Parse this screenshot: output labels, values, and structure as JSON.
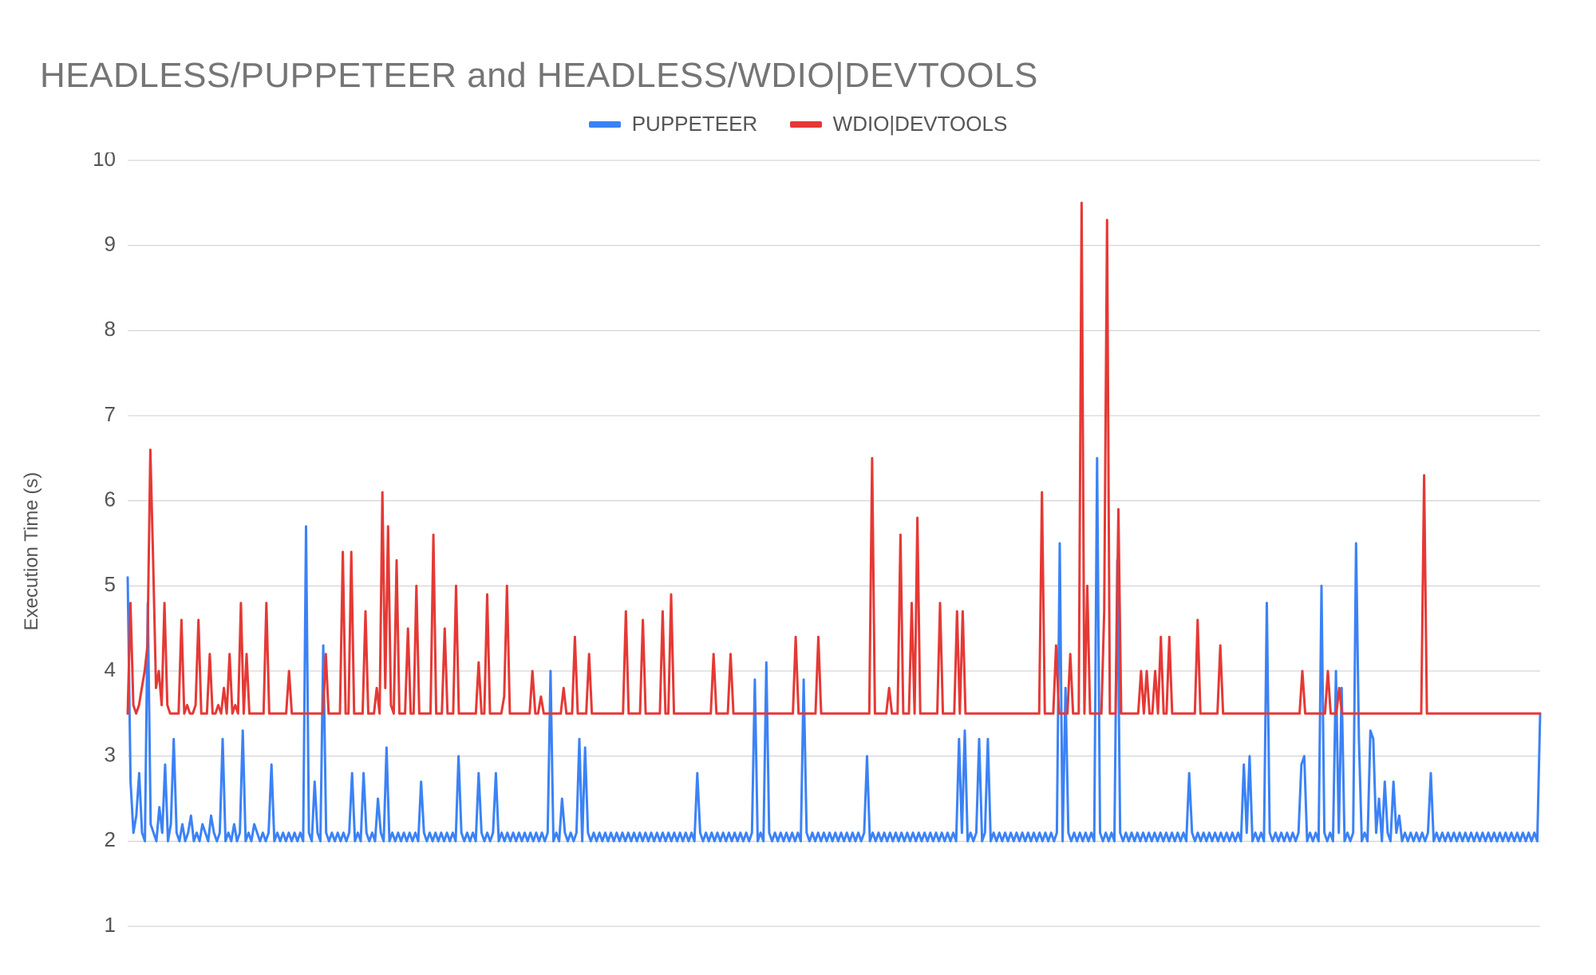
{
  "title": "HEADLESS/PUPPETEER and HEADLESS/WDIO|DEVTOOLS",
  "legend": {
    "series1": {
      "label": "PUPPETEER",
      "color": "#3b82f6"
    },
    "series2": {
      "label": "WDIO|DEVTOOLS",
      "color": "#e53935"
    }
  },
  "ylabel": "Execution Time (s)",
  "chart_data": {
    "type": "line",
    "title": "HEADLESS/PUPPETEER and HEADLESS/WDIO|DEVTOOLS",
    "xlabel": "",
    "ylabel": "Execution Time (s)",
    "ylim": [
      1,
      10
    ],
    "yticks": [
      1,
      2,
      3,
      4,
      5,
      6,
      7,
      8,
      9,
      10
    ],
    "x_count": 500,
    "series": [
      {
        "name": "PUPPETEER",
        "color": "#3b82f6",
        "values": [
          5.1,
          2.7,
          2.1,
          2.3,
          2.8,
          2.1,
          2.0,
          4.8,
          2.2,
          2.1,
          2.0,
          2.4,
          2.1,
          2.9,
          2.0,
          2.2,
          3.2,
          2.1,
          2.0,
          2.2,
          2.0,
          2.1,
          2.3,
          2.0,
          2.1,
          2.0,
          2.2,
          2.1,
          2.0,
          2.3,
          2.1,
          2.0,
          2.1,
          3.2,
          2.0,
          2.1,
          2.0,
          2.2,
          2.0,
          2.1,
          3.3,
          2.0,
          2.1,
          2.0,
          2.2,
          2.1,
          2.0,
          2.1,
          2.0,
          2.1,
          2.9,
          2.0,
          2.1,
          2.0,
          2.1,
          2.0,
          2.1,
          2.0,
          2.1,
          2.0,
          2.1,
          2.0,
          5.7,
          2.1,
          2.0,
          2.7,
          2.1,
          2.0,
          4.3,
          2.1,
          2.0,
          2.1,
          2.0,
          2.1,
          2.0,
          2.1,
          2.0,
          2.1,
          2.8,
          2.0,
          2.1,
          2.0,
          2.8,
          2.1,
          2.0,
          2.1,
          2.0,
          2.5,
          2.1,
          2.0,
          3.1,
          2.0,
          2.1,
          2.0,
          2.1,
          2.0,
          2.1,
          2.0,
          2.1,
          2.0,
          2.1,
          2.0,
          2.7,
          2.1,
          2.0,
          2.1,
          2.0,
          2.1,
          2.0,
          2.1,
          2.0,
          2.1,
          2.0,
          2.1,
          2.0,
          3.0,
          2.1,
          2.0,
          2.1,
          2.0,
          2.1,
          2.0,
          2.8,
          2.1,
          2.0,
          2.1,
          2.0,
          2.1,
          2.8,
          2.0,
          2.1,
          2.0,
          2.1,
          2.0,
          2.1,
          2.0,
          2.1,
          2.0,
          2.1,
          2.0,
          2.1,
          2.0,
          2.1,
          2.0,
          2.1,
          2.0,
          2.1,
          4.0,
          2.0,
          2.1,
          2.0,
          2.5,
          2.1,
          2.0,
          2.1,
          2.0,
          2.1,
          3.2,
          2.0,
          3.1,
          2.1,
          2.0,
          2.1,
          2.0,
          2.1,
          2.0,
          2.1,
          2.0,
          2.1,
          2.0,
          2.1,
          2.0,
          2.1,
          2.0,
          2.1,
          2.0,
          2.1,
          2.0,
          2.1,
          2.0,
          2.1,
          2.0,
          2.1,
          2.0,
          2.1,
          2.0,
          2.1,
          2.0,
          2.1,
          2.0,
          2.1,
          2.0,
          2.1,
          2.0,
          2.1,
          2.0,
          2.1,
          2.0,
          2.8,
          2.1,
          2.0,
          2.1,
          2.0,
          2.1,
          2.0,
          2.1,
          2.0,
          2.1,
          2.0,
          2.1,
          2.0,
          2.1,
          2.0,
          2.1,
          2.0,
          2.1,
          2.0,
          2.1,
          3.9,
          2.0,
          2.1,
          2.0,
          4.1,
          2.1,
          2.0,
          2.1,
          2.0,
          2.1,
          2.0,
          2.1,
          2.0,
          2.1,
          2.0,
          2.1,
          2.0,
          3.9,
          2.1,
          2.0,
          2.1,
          2.0,
          2.1,
          2.0,
          2.1,
          2.0,
          2.1,
          2.0,
          2.1,
          2.0,
          2.1,
          2.0,
          2.1,
          2.0,
          2.1,
          2.0,
          2.1,
          2.0,
          2.1,
          3.0,
          2.0,
          2.1,
          2.0,
          2.1,
          2.0,
          2.1,
          2.0,
          2.1,
          2.0,
          2.1,
          2.0,
          2.1,
          2.0,
          2.1,
          2.0,
          2.1,
          2.0,
          2.1,
          2.0,
          2.1,
          2.0,
          2.1,
          2.0,
          2.1,
          2.0,
          2.1,
          2.0,
          2.1,
          2.0,
          2.1,
          2.0,
          3.2,
          2.1,
          3.3,
          2.0,
          2.1,
          2.0,
          2.1,
          3.2,
          2.0,
          2.1,
          3.2,
          2.0,
          2.1,
          2.0,
          2.1,
          2.0,
          2.1,
          2.0,
          2.1,
          2.0,
          2.1,
          2.0,
          2.1,
          2.0,
          2.1,
          2.0,
          2.1,
          2.0,
          2.1,
          2.0,
          2.1,
          2.0,
          2.1,
          2.0,
          2.1,
          5.5,
          2.0,
          3.8,
          2.1,
          2.0,
          2.1,
          2.0,
          2.1,
          2.0,
          2.1,
          2.0,
          2.1,
          2.0,
          6.5,
          2.1,
          2.0,
          2.1,
          2.0,
          2.1,
          2.0,
          5.3,
          2.1,
          2.0,
          2.1,
          2.0,
          2.1,
          2.0,
          2.1,
          2.0,
          2.1,
          2.0,
          2.1,
          2.0,
          2.1,
          2.0,
          2.1,
          2.0,
          2.1,
          2.0,
          2.1,
          2.0,
          2.1,
          2.0,
          2.1,
          2.0,
          2.8,
          2.1,
          2.0,
          2.1,
          2.0,
          2.1,
          2.0,
          2.1,
          2.0,
          2.1,
          2.0,
          2.1,
          2.0,
          2.1,
          2.0,
          2.1,
          2.0,
          2.1,
          2.0,
          2.9,
          2.1,
          3.0,
          2.0,
          2.1,
          2.0,
          2.1,
          2.0,
          4.8,
          2.1,
          2.0,
          2.1,
          2.0,
          2.1,
          2.0,
          2.1,
          2.0,
          2.1,
          2.0,
          2.1,
          2.9,
          3.0,
          2.0,
          2.1,
          2.0,
          2.1,
          2.0,
          5.0,
          2.1,
          2.0,
          2.1,
          2.0,
          4.0,
          2.1,
          3.8,
          2.0,
          2.1,
          2.0,
          2.1,
          5.5,
          3.2,
          2.0,
          2.1,
          2.0,
          3.3,
          3.2,
          2.1,
          2.5,
          2.0,
          2.7,
          2.1,
          2.0,
          2.7,
          2.1,
          2.3,
          2.0,
          2.1,
          2.0,
          2.1,
          2.0,
          2.1,
          2.0,
          2.1,
          2.0,
          2.1,
          2.8,
          2.0,
          2.1,
          2.0,
          2.1,
          2.0,
          2.1,
          2.0,
          2.1,
          2.0,
          2.1,
          2.0,
          2.1,
          2.0,
          2.1,
          2.0,
          2.1,
          2.0,
          2.1,
          2.0,
          2.1,
          2.0,
          2.1,
          2.0,
          2.1,
          2.0,
          2.1,
          2.0,
          2.1,
          2.0,
          2.1,
          2.0,
          2.1,
          2.0,
          2.1,
          2.0,
          2.1,
          2.0,
          3.5
        ]
      },
      {
        "name": "WDIO|DEVTOOLS",
        "color": "#e53935",
        "values": [
          3.5,
          4.8,
          3.6,
          3.5,
          3.6,
          3.8,
          4.0,
          4.3,
          6.6,
          5.3,
          3.8,
          4.0,
          3.6,
          4.8,
          3.6,
          3.5,
          3.5,
          3.5,
          3.5,
          4.6,
          3.5,
          3.6,
          3.5,
          3.5,
          3.6,
          4.6,
          3.5,
          3.5,
          3.5,
          4.2,
          3.5,
          3.5,
          3.6,
          3.5,
          3.8,
          3.5,
          4.2,
          3.5,
          3.6,
          3.5,
          4.8,
          3.5,
          4.2,
          3.5,
          3.5,
          3.5,
          3.5,
          3.5,
          3.5,
          4.8,
          3.5,
          3.5,
          3.5,
          3.5,
          3.5,
          3.5,
          3.5,
          4.0,
          3.5,
          3.5,
          3.5,
          3.5,
          3.5,
          3.5,
          3.5,
          3.5,
          3.5,
          3.5,
          3.5,
          3.5,
          4.2,
          3.5,
          3.5,
          3.5,
          3.5,
          3.5,
          5.4,
          3.5,
          3.5,
          5.4,
          3.5,
          3.5,
          3.5,
          3.5,
          4.7,
          3.5,
          3.5,
          3.5,
          3.8,
          3.5,
          6.1,
          3.8,
          5.7,
          3.6,
          3.5,
          5.3,
          3.5,
          3.5,
          3.5,
          4.5,
          3.5,
          3.5,
          5.0,
          3.5,
          3.5,
          3.5,
          3.5,
          3.5,
          5.6,
          3.5,
          3.5,
          3.5,
          4.5,
          3.5,
          3.5,
          3.5,
          5.0,
          3.5,
          3.5,
          3.5,
          3.5,
          3.5,
          3.5,
          3.5,
          4.1,
          3.5,
          3.5,
          4.9,
          3.5,
          3.5,
          3.5,
          3.5,
          3.5,
          3.7,
          5.0,
          3.5,
          3.5,
          3.5,
          3.5,
          3.5,
          3.5,
          3.5,
          3.5,
          4.0,
          3.5,
          3.5,
          3.7,
          3.5,
          3.5,
          3.5,
          3.5,
          3.5,
          3.5,
          3.5,
          3.8,
          3.5,
          3.5,
          3.5,
          4.4,
          3.5,
          3.5,
          3.5,
          3.5,
          4.2,
          3.5,
          3.5,
          3.5,
          3.5,
          3.5,
          3.5,
          3.5,
          3.5,
          3.5,
          3.5,
          3.5,
          3.5,
          4.7,
          3.5,
          3.5,
          3.5,
          3.5,
          3.5,
          4.6,
          3.5,
          3.5,
          3.5,
          3.5,
          3.5,
          3.5,
          4.7,
          3.5,
          3.5,
          4.9,
          3.5,
          3.5,
          3.5,
          3.5,
          3.5,
          3.5,
          3.5,
          3.5,
          3.5,
          3.5,
          3.5,
          3.5,
          3.5,
          3.5,
          4.2,
          3.5,
          3.5,
          3.5,
          3.5,
          3.5,
          4.2,
          3.5,
          3.5,
          3.5,
          3.5,
          3.5,
          3.5,
          3.5,
          3.5,
          3.5,
          3.5,
          3.5,
          3.5,
          3.5,
          3.5,
          3.5,
          3.5,
          3.5,
          3.5,
          3.5,
          3.5,
          3.5,
          3.5,
          4.4,
          3.5,
          3.5,
          3.5,
          3.5,
          3.5,
          3.5,
          3.5,
          4.4,
          3.5,
          3.5,
          3.5,
          3.5,
          3.5,
          3.5,
          3.5,
          3.5,
          3.5,
          3.5,
          3.5,
          3.5,
          3.5,
          3.5,
          3.5,
          3.5,
          3.5,
          3.5,
          6.5,
          3.5,
          3.5,
          3.5,
          3.5,
          3.5,
          3.8,
          3.5,
          3.5,
          3.5,
          5.6,
          3.5,
          3.5,
          3.5,
          4.8,
          3.5,
          5.8,
          3.5,
          3.5,
          3.5,
          3.5,
          3.5,
          3.5,
          3.5,
          4.8,
          3.5,
          3.5,
          3.5,
          3.5,
          3.5,
          4.7,
          3.5,
          4.7,
          3.5,
          3.5,
          3.5,
          3.5,
          3.5,
          3.5,
          3.5,
          3.5,
          3.5,
          3.5,
          3.5,
          3.5,
          3.5,
          3.5,
          3.5,
          3.5,
          3.5,
          3.5,
          3.5,
          3.5,
          3.5,
          3.5,
          3.5,
          3.5,
          3.5,
          3.5,
          3.5,
          6.1,
          3.5,
          3.5,
          3.5,
          3.5,
          4.3,
          3.5,
          3.5,
          3.5,
          3.5,
          4.2,
          3.5,
          3.5,
          3.5,
          9.5,
          3.5,
          5.0,
          3.5,
          3.5,
          3.5,
          3.5,
          3.5,
          4.7,
          9.3,
          3.5,
          3.5,
          3.5,
          5.9,
          3.5,
          3.5,
          3.5,
          3.5,
          3.5,
          3.5,
          3.5,
          4.0,
          3.5,
          4.0,
          3.5,
          3.5,
          4.0,
          3.5,
          4.4,
          3.5,
          3.5,
          4.4,
          3.5,
          3.5,
          3.5,
          3.5,
          3.5,
          3.5,
          3.5,
          3.5,
          3.5,
          4.6,
          3.5,
          3.5,
          3.5,
          3.5,
          3.5,
          3.5,
          3.5,
          4.3,
          3.5,
          3.5,
          3.5,
          3.5,
          3.5,
          3.5,
          3.5,
          3.5,
          3.5,
          3.5,
          3.5,
          3.5,
          3.5,
          3.5,
          3.5,
          3.5,
          3.5,
          3.5,
          3.5,
          3.5,
          3.5,
          3.5,
          3.5,
          3.5,
          3.5,
          3.5,
          3.5,
          3.5,
          4.0,
          3.5,
          3.5,
          3.5,
          3.5,
          3.5,
          3.5,
          3.5,
          3.5,
          4.0,
          3.5,
          3.5,
          3.5,
          3.8,
          3.5,
          3.5,
          3.5,
          3.5,
          3.5,
          3.5,
          3.5,
          3.5,
          3.5,
          3.5,
          3.5,
          3.5,
          3.5,
          3.5,
          3.5,
          3.5,
          3.5,
          3.5,
          3.5,
          3.5,
          3.5,
          3.5,
          3.5,
          3.5,
          3.5,
          3.5,
          3.5,
          3.5,
          3.5,
          6.3,
          3.5,
          3.5,
          3.5,
          3.5,
          3.5,
          3.5,
          3.5,
          3.5,
          3.5,
          3.5,
          3.5,
          3.5,
          3.5,
          3.5,
          3.5,
          3.5,
          3.5,
          3.5,
          3.5,
          3.5,
          3.5,
          3.5,
          3.5,
          3.5,
          3.5,
          3.5,
          3.5,
          3.5,
          3.5,
          3.5,
          3.5,
          3.5,
          3.5,
          3.5,
          3.5,
          3.5,
          3.5,
          3.5,
          3.5,
          3.5,
          3.5
        ]
      }
    ]
  }
}
